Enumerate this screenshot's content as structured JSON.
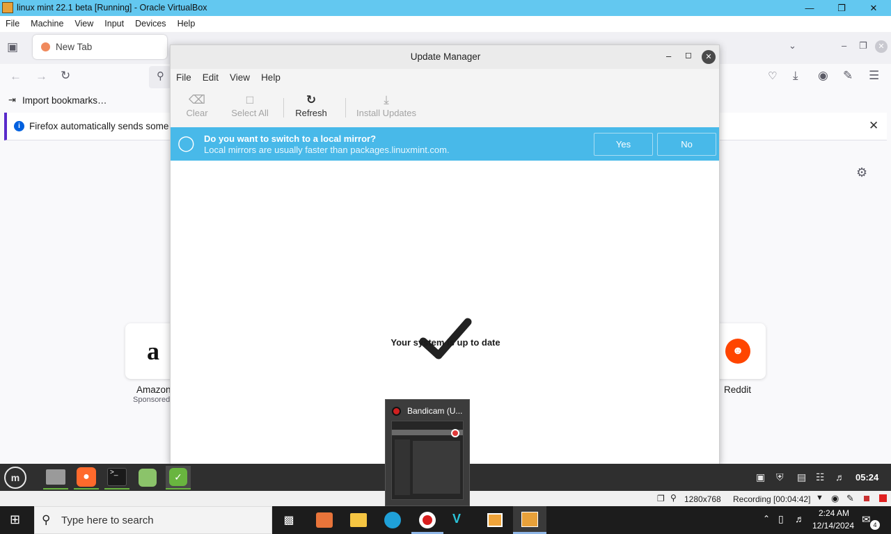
{
  "vbox": {
    "title": "linux mint 22.1 beta [Running] - Oracle VirtualBox",
    "menu": [
      "File",
      "Machine",
      "View",
      "Input",
      "Devices",
      "Help"
    ],
    "status": {
      "resolution": "1280x768",
      "recording": "Recording [00:04:42]"
    }
  },
  "firefox": {
    "tab_title": "New Tab",
    "import_bookmarks": "Import bookmarks…",
    "notice_text": "Firefox automatically sends some",
    "shortcuts": [
      {
        "label": "Amazon",
        "sublabel": "Sponsored"
      },
      {
        "label": "Reddit"
      }
    ]
  },
  "update_manager": {
    "title": "Update Manager",
    "menu": [
      "File",
      "Edit",
      "View",
      "Help"
    ],
    "toolbar": {
      "clear": "Clear",
      "select_all": "Select All",
      "refresh": "Refresh",
      "install": "Install Updates"
    },
    "infobar": {
      "question": "Do you want to switch to a local mirror?",
      "detail": "Local mirrors are usually faster than packages.linuxmint.com.",
      "yes": "Yes",
      "no": "No"
    },
    "status_message": "Your system is up to date"
  },
  "mint_panel": {
    "clock": "05:24"
  },
  "bandicam": {
    "title": "Bandicam (U..."
  },
  "windows_taskbar": {
    "search_placeholder": "Type here to search",
    "time": "2:24 AM",
    "date": "12/14/2024",
    "notification_count": "4"
  },
  "colors": {
    "vbox_title": "#63c8f0",
    "infobar": "#48b9e9",
    "mint_panel": "#2f2f2f",
    "mint_green": "#69b53f",
    "firefox_orange": "#ff6a2c"
  }
}
